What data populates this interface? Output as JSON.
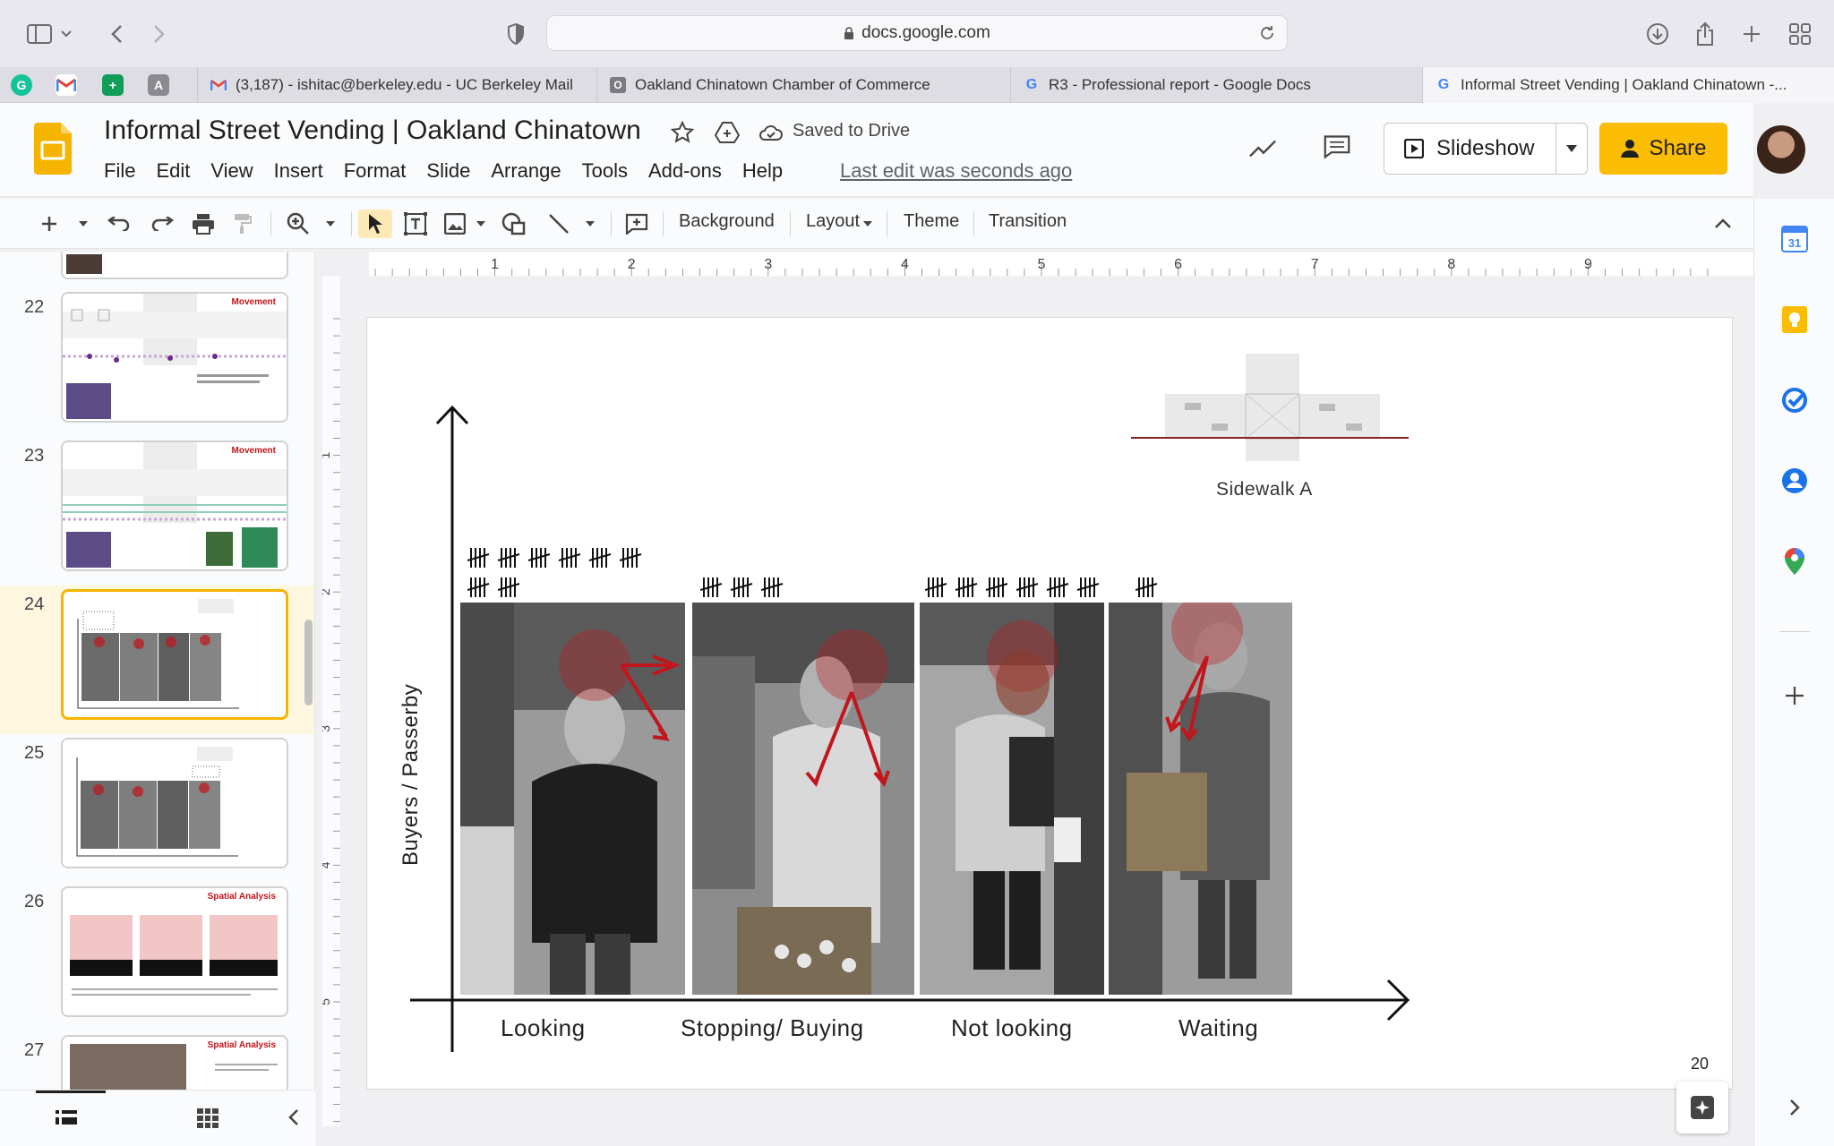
{
  "browser": {
    "url": "docs.google.com",
    "tabs": [
      {
        "label": "(3,187) - ishitac@berkeley.edu - UC Berkeley Mail",
        "active": false
      },
      {
        "label": "Oakland Chinatown Chamber of Commerce",
        "active": false
      },
      {
        "label": "R3 - Professional report - Google Docs",
        "active": false
      },
      {
        "label": "Informal Street Vending | Oakland Chinatown -...",
        "active": true
      }
    ]
  },
  "doc": {
    "title": "Informal Street Vending | Oakland Chinatown",
    "saved_status": "Saved to Drive",
    "menu": [
      "File",
      "Edit",
      "View",
      "Insert",
      "Format",
      "Slide",
      "Arrange",
      "Tools",
      "Add-ons",
      "Help"
    ],
    "last_edit": "Last edit was seconds ago",
    "slideshow_label": "Slideshow",
    "share_label": "Share"
  },
  "toolbar": {
    "background_label": "Background",
    "layout_label": "Layout",
    "theme_label": "Theme",
    "transition_label": "Transition"
  },
  "ruler": {
    "horizontal": [
      "1",
      "2",
      "3",
      "4",
      "5",
      "6",
      "7",
      "8",
      "9"
    ],
    "vertical": [
      "1",
      "2",
      "3",
      "4",
      "5"
    ]
  },
  "filmstrip": {
    "slides": [
      {
        "num": "22",
        "title": "Movement",
        "current": false
      },
      {
        "num": "23",
        "title": "Movement",
        "current": false
      },
      {
        "num": "24",
        "title": "",
        "current": true
      },
      {
        "num": "25",
        "title": "",
        "current": false
      },
      {
        "num": "26",
        "title": "Spatial Analysis",
        "current": false
      },
      {
        "num": "27",
        "title": "Spatial Analysis",
        "current": false
      }
    ]
  },
  "slide": {
    "number": "20",
    "y_axis_label": "Buyers / Passerby",
    "sidewalk_label": "Sidewalk A",
    "categories": [
      "Looking",
      "Stopping/ Buying",
      "Not looking",
      "Waiting"
    ],
    "tally_counts": [
      40,
      15,
      30,
      5
    ],
    "accent_color": "#c0161c"
  }
}
